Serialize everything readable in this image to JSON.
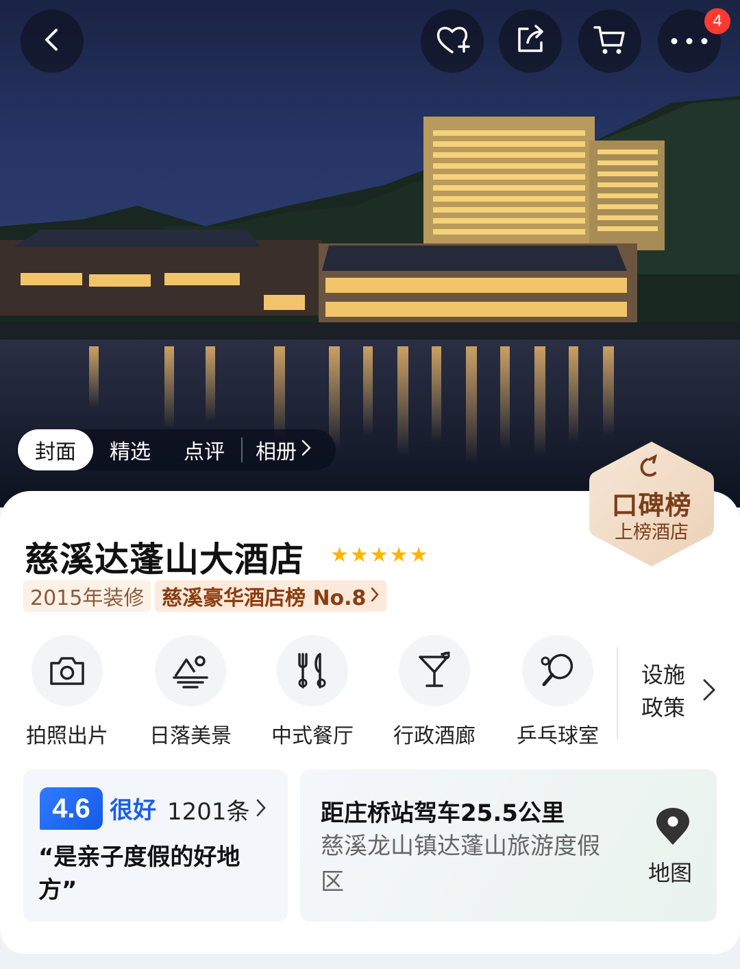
{
  "header": {
    "notification_count": "4",
    "icons": [
      "back-icon",
      "favorite-add-icon",
      "share-icon",
      "cart-icon",
      "more-icon"
    ]
  },
  "gallery_tabs": [
    {
      "label": "封面"
    },
    {
      "label": "精选"
    },
    {
      "label": "点评"
    },
    {
      "label": "相册"
    }
  ],
  "award": {
    "title": "口碑榜",
    "subtitle": "上榜酒店"
  },
  "hotel": {
    "name": "慈溪达蓬山大酒店",
    "stars": "★★★★★",
    "renovation": "2015年装修",
    "ranking": "慈溪豪华酒店榜 No.8"
  },
  "facilities": [
    {
      "label": "拍照出片",
      "icon": "camera-icon"
    },
    {
      "label": "日落美景",
      "icon": "sunset-icon"
    },
    {
      "label": "中式餐厅",
      "icon": "restaurant-icon"
    },
    {
      "label": "行政酒廊",
      "icon": "cocktail-icon"
    },
    {
      "label": "乒乓球室",
      "icon": "ping-pong-icon"
    }
  ],
  "policy": {
    "line1": "设施",
    "line2": "政策"
  },
  "review": {
    "score": "4.6",
    "rating_word": "很好",
    "count": "1201条",
    "quote": "“是亲子度假的好地方”"
  },
  "location": {
    "distance": "距庄桥站驾车25.5公里",
    "address": "慈溪龙山镇达蓬山旅游度假区",
    "map_label": "地图"
  },
  "colors": {
    "accent_blue": "#1a5fe6",
    "star_yellow": "#ffb400",
    "badge_red": "#ff3b30",
    "rank_brown": "#8a3d10"
  }
}
